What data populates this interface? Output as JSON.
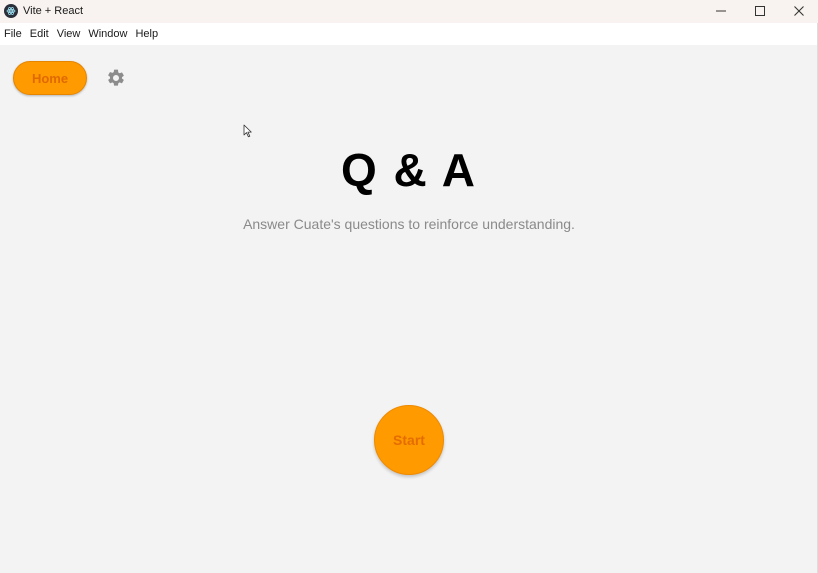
{
  "window": {
    "title": "Vite + React",
    "app_icon": "electron-icon",
    "controls": [
      "minimize-icon",
      "maximize-icon",
      "close-icon"
    ]
  },
  "menu": {
    "items": [
      "File",
      "Edit",
      "View",
      "Window",
      "Help"
    ]
  },
  "nav": {
    "home_label": "Home",
    "settings_icon": "gear-icon"
  },
  "main": {
    "title": "Q & A",
    "subtitle": "Answer Cuate's questions to reinforce understanding.",
    "start_label": "Start"
  },
  "colors": {
    "accent": "#ff9a00",
    "accent_text": "#e06a00",
    "background": "#f3f3f3"
  }
}
